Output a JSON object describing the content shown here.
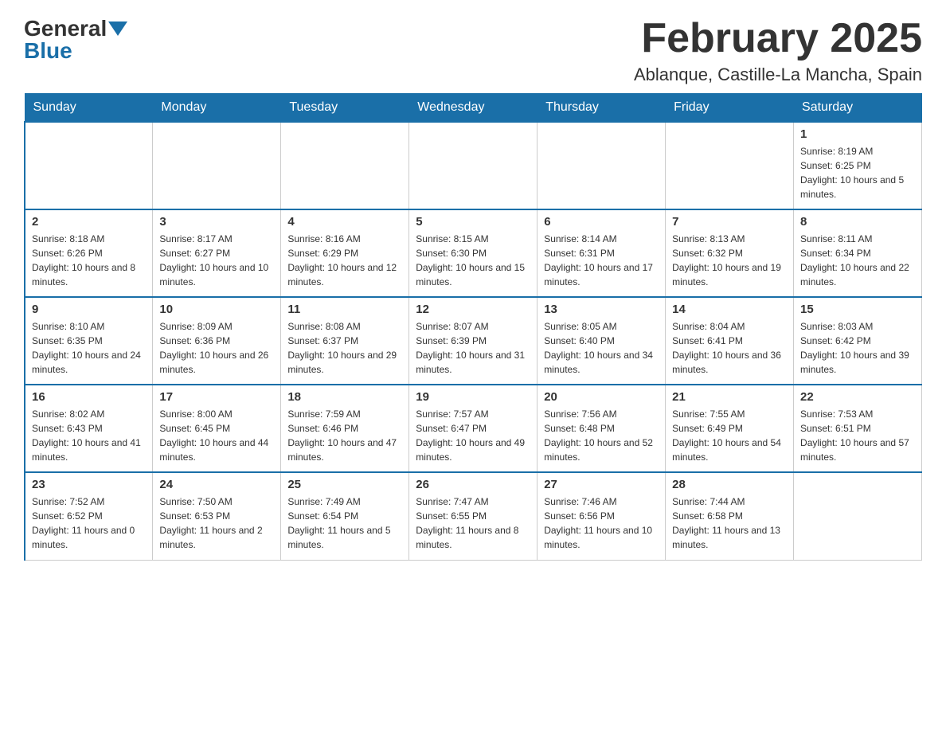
{
  "header": {
    "logo": {
      "general": "General",
      "blue": "Blue"
    },
    "title": "February 2025",
    "location": "Ablanque, Castille-La Mancha, Spain"
  },
  "weekdays": [
    "Sunday",
    "Monday",
    "Tuesday",
    "Wednesday",
    "Thursday",
    "Friday",
    "Saturday"
  ],
  "weeks": [
    [
      {
        "day": "",
        "info": ""
      },
      {
        "day": "",
        "info": ""
      },
      {
        "day": "",
        "info": ""
      },
      {
        "day": "",
        "info": ""
      },
      {
        "day": "",
        "info": ""
      },
      {
        "day": "",
        "info": ""
      },
      {
        "day": "1",
        "info": "Sunrise: 8:19 AM\nSunset: 6:25 PM\nDaylight: 10 hours and 5 minutes."
      }
    ],
    [
      {
        "day": "2",
        "info": "Sunrise: 8:18 AM\nSunset: 6:26 PM\nDaylight: 10 hours and 8 minutes."
      },
      {
        "day": "3",
        "info": "Sunrise: 8:17 AM\nSunset: 6:27 PM\nDaylight: 10 hours and 10 minutes."
      },
      {
        "day": "4",
        "info": "Sunrise: 8:16 AM\nSunset: 6:29 PM\nDaylight: 10 hours and 12 minutes."
      },
      {
        "day": "5",
        "info": "Sunrise: 8:15 AM\nSunset: 6:30 PM\nDaylight: 10 hours and 15 minutes."
      },
      {
        "day": "6",
        "info": "Sunrise: 8:14 AM\nSunset: 6:31 PM\nDaylight: 10 hours and 17 minutes."
      },
      {
        "day": "7",
        "info": "Sunrise: 8:13 AM\nSunset: 6:32 PM\nDaylight: 10 hours and 19 minutes."
      },
      {
        "day": "8",
        "info": "Sunrise: 8:11 AM\nSunset: 6:34 PM\nDaylight: 10 hours and 22 minutes."
      }
    ],
    [
      {
        "day": "9",
        "info": "Sunrise: 8:10 AM\nSunset: 6:35 PM\nDaylight: 10 hours and 24 minutes."
      },
      {
        "day": "10",
        "info": "Sunrise: 8:09 AM\nSunset: 6:36 PM\nDaylight: 10 hours and 26 minutes."
      },
      {
        "day": "11",
        "info": "Sunrise: 8:08 AM\nSunset: 6:37 PM\nDaylight: 10 hours and 29 minutes."
      },
      {
        "day": "12",
        "info": "Sunrise: 8:07 AM\nSunset: 6:39 PM\nDaylight: 10 hours and 31 minutes."
      },
      {
        "day": "13",
        "info": "Sunrise: 8:05 AM\nSunset: 6:40 PM\nDaylight: 10 hours and 34 minutes."
      },
      {
        "day": "14",
        "info": "Sunrise: 8:04 AM\nSunset: 6:41 PM\nDaylight: 10 hours and 36 minutes."
      },
      {
        "day": "15",
        "info": "Sunrise: 8:03 AM\nSunset: 6:42 PM\nDaylight: 10 hours and 39 minutes."
      }
    ],
    [
      {
        "day": "16",
        "info": "Sunrise: 8:02 AM\nSunset: 6:43 PM\nDaylight: 10 hours and 41 minutes."
      },
      {
        "day": "17",
        "info": "Sunrise: 8:00 AM\nSunset: 6:45 PM\nDaylight: 10 hours and 44 minutes."
      },
      {
        "day": "18",
        "info": "Sunrise: 7:59 AM\nSunset: 6:46 PM\nDaylight: 10 hours and 47 minutes."
      },
      {
        "day": "19",
        "info": "Sunrise: 7:57 AM\nSunset: 6:47 PM\nDaylight: 10 hours and 49 minutes."
      },
      {
        "day": "20",
        "info": "Sunrise: 7:56 AM\nSunset: 6:48 PM\nDaylight: 10 hours and 52 minutes."
      },
      {
        "day": "21",
        "info": "Sunrise: 7:55 AM\nSunset: 6:49 PM\nDaylight: 10 hours and 54 minutes."
      },
      {
        "day": "22",
        "info": "Sunrise: 7:53 AM\nSunset: 6:51 PM\nDaylight: 10 hours and 57 minutes."
      }
    ],
    [
      {
        "day": "23",
        "info": "Sunrise: 7:52 AM\nSunset: 6:52 PM\nDaylight: 11 hours and 0 minutes."
      },
      {
        "day": "24",
        "info": "Sunrise: 7:50 AM\nSunset: 6:53 PM\nDaylight: 11 hours and 2 minutes."
      },
      {
        "day": "25",
        "info": "Sunrise: 7:49 AM\nSunset: 6:54 PM\nDaylight: 11 hours and 5 minutes."
      },
      {
        "day": "26",
        "info": "Sunrise: 7:47 AM\nSunset: 6:55 PM\nDaylight: 11 hours and 8 minutes."
      },
      {
        "day": "27",
        "info": "Sunrise: 7:46 AM\nSunset: 6:56 PM\nDaylight: 11 hours and 10 minutes."
      },
      {
        "day": "28",
        "info": "Sunrise: 7:44 AM\nSunset: 6:58 PM\nDaylight: 11 hours and 13 minutes."
      },
      {
        "day": "",
        "info": ""
      }
    ]
  ]
}
